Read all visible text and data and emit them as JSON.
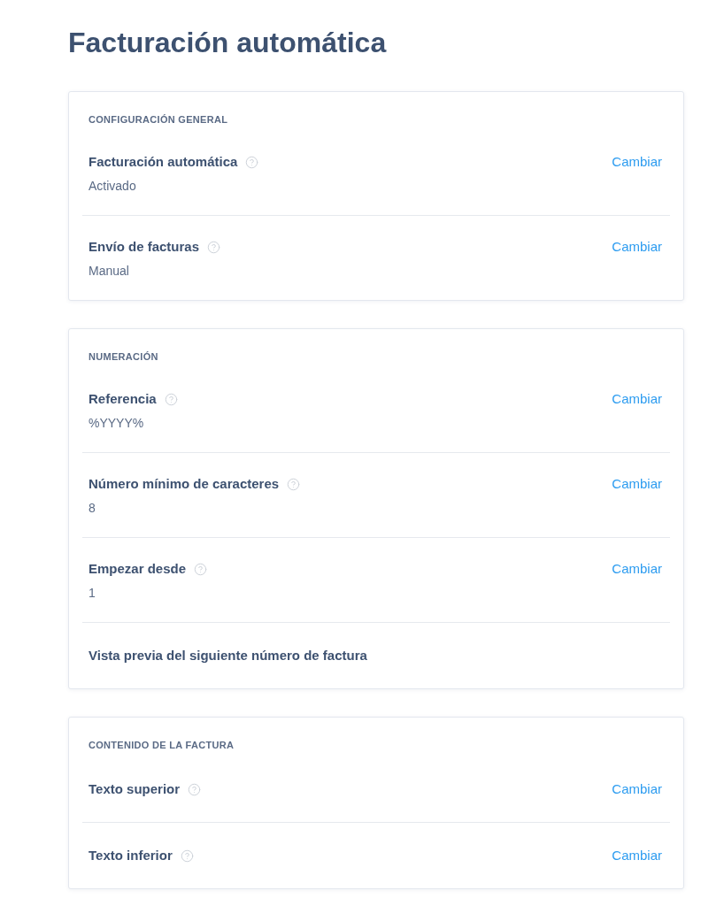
{
  "title": "Facturación automática",
  "sections": [
    {
      "heading": "CONFIGURACIÓN GENERAL",
      "rows": [
        {
          "label": "Facturación automática",
          "help": true,
          "value": "Activado",
          "action": "Cambiar"
        },
        {
          "label": "Envío de facturas",
          "help": true,
          "value": "Manual",
          "action": "Cambiar"
        }
      ]
    },
    {
      "heading": "NUMERACIÓN",
      "rows": [
        {
          "label": "Referencia",
          "help": true,
          "value": "%YYYY%",
          "action": "Cambiar"
        },
        {
          "label": "Número mínimo de caracteres",
          "help": true,
          "value": "8",
          "action": "Cambiar"
        },
        {
          "label": "Empezar desde",
          "help": true,
          "value": "1",
          "action": "Cambiar"
        },
        {
          "label": "Vista previa del siguiente número de factura",
          "help": false
        }
      ]
    },
    {
      "heading": "CONTENIDO DE LA FACTURA",
      "rows": [
        {
          "label": "Texto superior",
          "help": true,
          "action": "Cambiar"
        },
        {
          "label": "Texto inferior",
          "help": true,
          "action": "Cambiar"
        }
      ]
    }
  ]
}
